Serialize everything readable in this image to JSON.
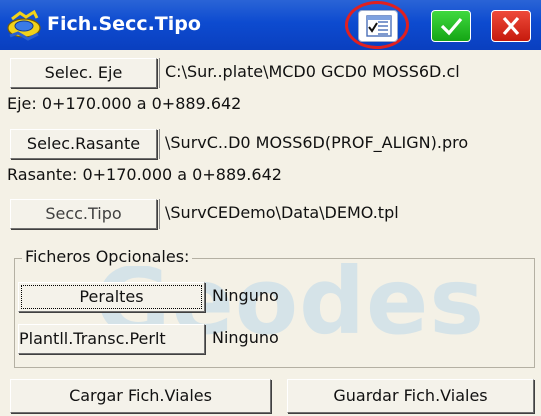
{
  "window": {
    "title": "Fich.Secc.Tipo",
    "icons": {
      "app": "yellow-blue-gear-icon",
      "list": "list-check-icon",
      "ok": "check-icon",
      "close": "close-icon"
    },
    "colors": {
      "titlebar": "#0d4bd0",
      "ok": "#21b521",
      "close": "#d9261a",
      "highlight_ring": "#e02020"
    }
  },
  "alignment": {
    "button_label": "Selec. Eje",
    "file_path": "C:\\Sur..plate\\MCD0 GCD0 MOSS6D.cl",
    "range_text": "Eje: 0+170.000 a 0+889.642"
  },
  "profile": {
    "button_label": "Selec.Rasante",
    "file_path": "\\SurvC..D0 MOSS6D(PROF_ALIGN).pro",
    "range_text": "Rasante: 0+170.000 a 0+889.642"
  },
  "template": {
    "button_label": "Secc.Tipo",
    "file_path": "\\SurvCEDemo\\Data\\DEMO.tpl"
  },
  "optional_files": {
    "group_label": "Ficheros Opcionales:",
    "superelevation": {
      "button_label": "Peraltes",
      "value": "Ninguno"
    },
    "transition": {
      "button_label": "Plantll.Transc.Perlt",
      "value": "Ninguno"
    }
  },
  "watermark": "Geodes",
  "footer": {
    "load_label": "Cargar Fich.Viales",
    "save_label": "Guardar Fich.Viales"
  }
}
